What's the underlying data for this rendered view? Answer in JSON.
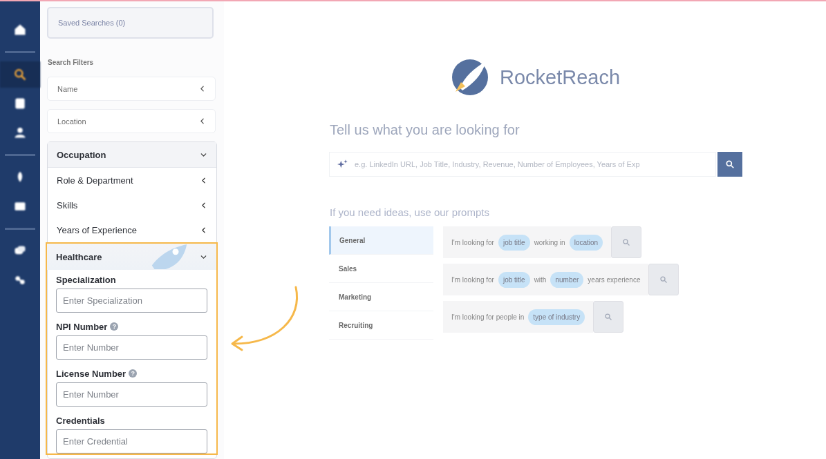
{
  "nav": {
    "items": [
      {
        "kind": "button",
        "selected": false
      },
      {
        "kind": "divider"
      },
      {
        "kind": "button",
        "selected": true
      },
      {
        "kind": "button",
        "selected": false
      },
      {
        "kind": "button",
        "selected": false
      },
      {
        "kind": "divider"
      },
      {
        "kind": "button",
        "selected": false
      },
      {
        "kind": "button",
        "selected": false
      },
      {
        "kind": "divider"
      },
      {
        "kind": "button",
        "selected": false
      },
      {
        "kind": "button",
        "selected": false
      }
    ]
  },
  "filters": {
    "saved_searches": "Saved Searches (0)",
    "heading": "Search Filters",
    "collapsed": [
      {
        "label": "Name"
      },
      {
        "label": "Location"
      }
    ],
    "groups": [
      {
        "title": "Occupation",
        "expanded": true,
        "highlighted": false,
        "items": [
          {
            "label": "Role & Department"
          },
          {
            "label": "Skills"
          },
          {
            "label": "Years of Experience"
          }
        ]
      },
      {
        "title": "Healthcare",
        "expanded": true,
        "highlighted": true,
        "fields": [
          {
            "label": "Specialization",
            "placeholder": "Enter Specialization"
          },
          {
            "label": "NPI Number",
            "help": "?",
            "placeholder": "Enter Number"
          },
          {
            "label": "License Number",
            "help": "?",
            "placeholder": "Enter Number"
          },
          {
            "label": "Credentials",
            "placeholder": "Enter Credential"
          }
        ]
      }
    ]
  },
  "main": {
    "brand": "RocketReach",
    "heading": "Tell us what you are looking for",
    "search": {
      "placeholder": "e.g. LinkedIn URL, Job Title, Industry, Revenue, Number of Employees, Years of Exp"
    },
    "prompts_heading": "If you need ideas, use our prompts",
    "prompt_tabs": [
      {
        "label": "General",
        "selected": true
      },
      {
        "label": "Sales",
        "selected": false
      },
      {
        "label": "Marketing",
        "selected": false
      },
      {
        "label": "Recruiting",
        "selected": false
      }
    ],
    "prompts": [
      {
        "parts": [
          {
            "kind": "text",
            "text": "I'm looking for"
          },
          {
            "kind": "chip",
            "text": "job title"
          },
          {
            "kind": "text",
            "text": "working in"
          },
          {
            "kind": "chip",
            "text": "location"
          }
        ]
      },
      {
        "parts": [
          {
            "kind": "text",
            "text": "I'm looking for"
          },
          {
            "kind": "chip",
            "text": "job title"
          },
          {
            "kind": "text",
            "text": "with"
          },
          {
            "kind": "chip",
            "text": "number"
          },
          {
            "kind": "text",
            "text": "years experience"
          }
        ]
      },
      {
        "parts": [
          {
            "kind": "text",
            "text": "I'm looking for people in"
          },
          {
            "kind": "chip",
            "text": "type of industry"
          }
        ]
      }
    ]
  }
}
